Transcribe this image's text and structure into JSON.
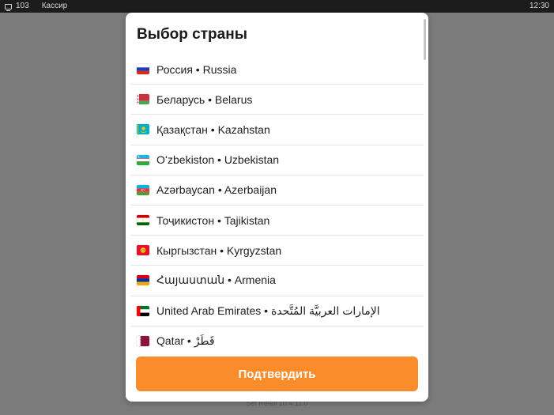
{
  "status_bar": {
    "terminal_number": "103",
    "role": "Кассир",
    "clock": "12:30"
  },
  "version_text": "Set Retail 10.4.11.0",
  "dialog": {
    "title": "Выбор страны",
    "confirm_label": "Подтвердить",
    "accent_color": "#fb8c2c",
    "countries": [
      {
        "label": "Россия • Russia",
        "flag_icon": "flag-russia-icon"
      },
      {
        "label": "Беларусь • Belarus",
        "flag_icon": "flag-belarus-icon"
      },
      {
        "label": "Қазақстан • Kazahstan",
        "flag_icon": "flag-kazakhstan-icon"
      },
      {
        "label": "Oʻzbekiston • Uzbekistan",
        "flag_icon": "flag-uzbekistan-icon"
      },
      {
        "label": "Azərbaycan • Azerbaijan",
        "flag_icon": "flag-azerbaijan-icon"
      },
      {
        "label": "Тоҷикистон • Tajikistan",
        "flag_icon": "flag-tajikistan-icon"
      },
      {
        "label": "Кыргызстан • Kyrgyzstan",
        "flag_icon": "flag-kyrgyzstan-icon"
      },
      {
        "label": "Հայաստան • Armenia",
        "flag_icon": "flag-armenia-icon"
      },
      {
        "label": "United Arab Emirates • الإمارات العربيَّة المُتَّحدة",
        "flag_icon": "flag-uae-icon"
      },
      {
        "label": "Qatar • قَطَرْ",
        "flag_icon": "flag-qatar-icon"
      }
    ]
  }
}
